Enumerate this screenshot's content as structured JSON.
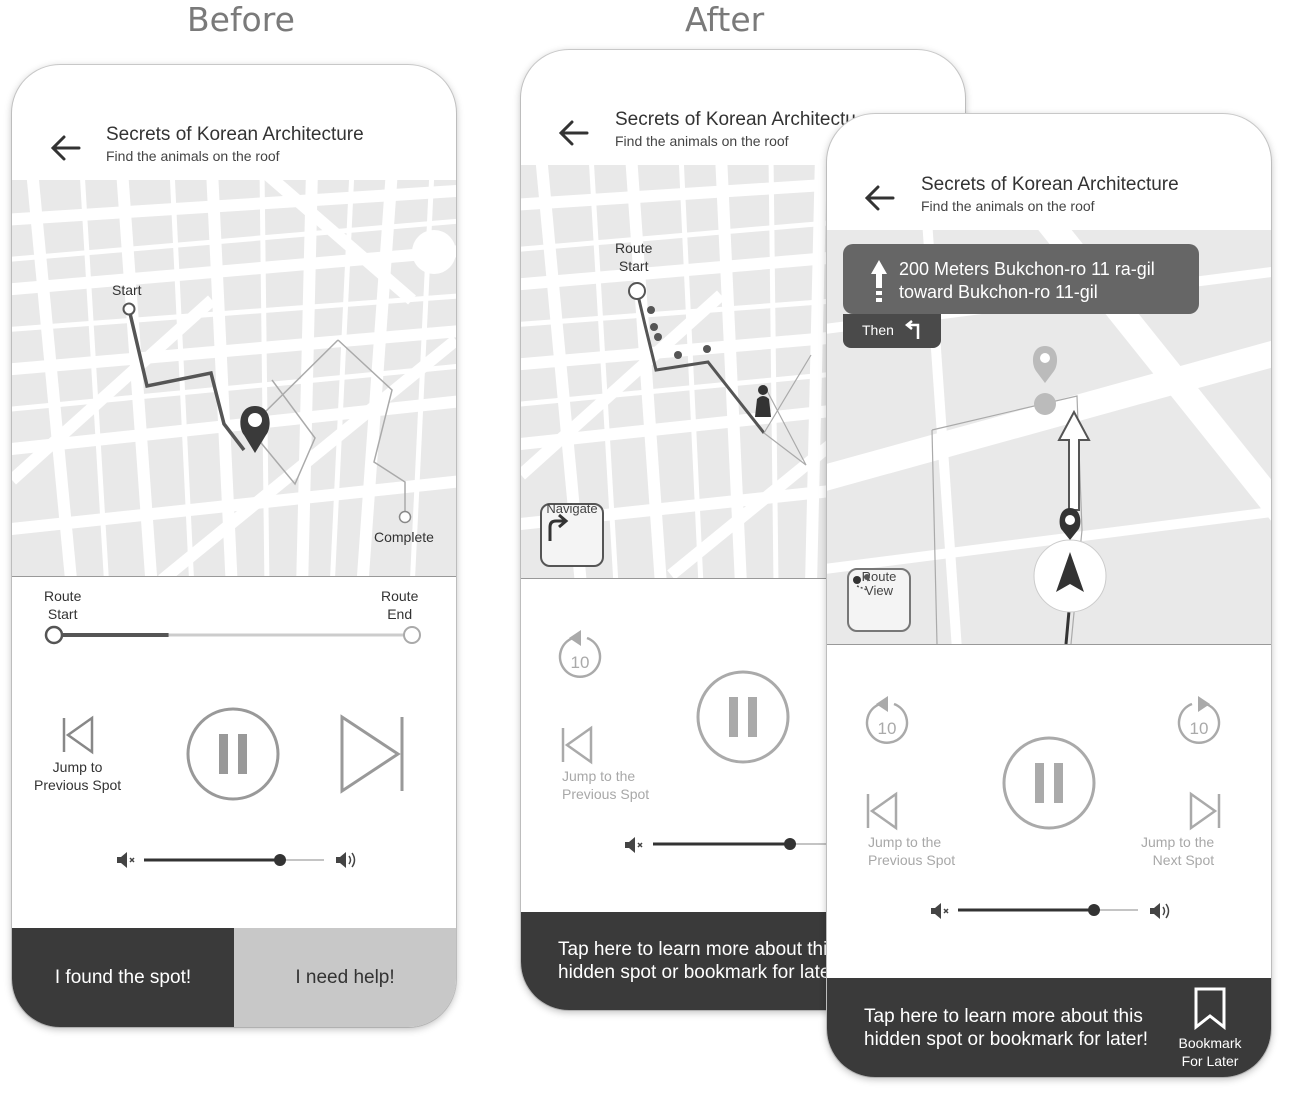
{
  "headings": {
    "before": "Before",
    "after": "After"
  },
  "screen": {
    "title": "Secrets of Korean Architecture",
    "subtitle": "Find the animals on the roof"
  },
  "before": {
    "map": {
      "start_label": "Start",
      "complete_label": "Complete"
    },
    "progress": {
      "start_label_line1": "Route",
      "start_label_line2": "Start",
      "end_label_line1": "Route",
      "end_label_line2": "End",
      "value": 0.32
    },
    "controls": {
      "prev_label_line1": "Jump to",
      "prev_label_line2": "Previous Spot"
    },
    "volume": 0.75,
    "found_button": "I found the spot!",
    "help_button": "I need help!"
  },
  "after_back": {
    "title_visible": "Secrets of Korean Architectu",
    "map": {
      "route_label_line1": "Route",
      "route_label_line2": "Start"
    },
    "navigate_label": "Navigate",
    "rewind_value": "10",
    "prev_label_line1": "Jump to the",
    "prev_label_line2": "Previous Spot",
    "banner_line1": "Tap here to learn more about thi",
    "banner_line2": "hidden spot or bookmark for late"
  },
  "after_front": {
    "direction_line1": "200 Meters Bukchon-ro 11 ra-gil",
    "direction_line2": "toward Bukchon-ro 11-gil",
    "then_label": "Then",
    "route_view_line1": "Route",
    "route_view_line2": "View",
    "rewind_value": "10",
    "forward_value": "10",
    "prev_label_line1": "Jump to the",
    "prev_label_line2": "Previous Spot",
    "next_label_line1": "Jump to the",
    "next_label_line2": "Next Spot",
    "volume": 0.75,
    "banner_line1": "Tap here to learn more about this",
    "banner_line2": "hidden spot or bookmark for later!",
    "bookmark_line1": "Bookmark",
    "bookmark_line2": "For Later"
  },
  "colors": {
    "dark": "#3a3a3a",
    "light_button": "#c8c8c8",
    "map_bg": "#e9e9e9",
    "muted": "#a8a8a8"
  },
  "icons": [
    "back-arrow-icon",
    "map-pin-icon",
    "pause-icon",
    "skip-previous-icon",
    "skip-next-icon",
    "mute-icon",
    "volume-icon",
    "rewind-10-icon",
    "forward-10-icon",
    "navigate-turn-icon",
    "turn-left-icon",
    "straight-arrow-icon",
    "navigation-arrow-icon",
    "route-view-icon",
    "bookmark-icon",
    "person-icon"
  ]
}
